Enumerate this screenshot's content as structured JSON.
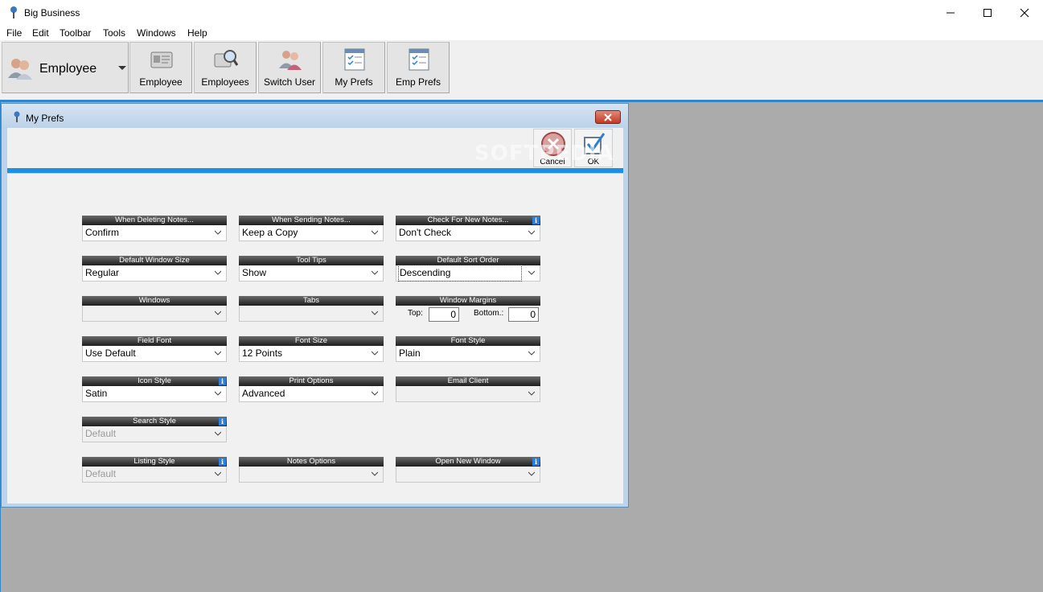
{
  "window": {
    "title": "Big Business"
  },
  "menu": [
    "File",
    "Edit",
    "Toolbar",
    "Tools",
    "Windows",
    "Help"
  ],
  "toolbar": {
    "selector": {
      "label": "Employee",
      "icon": "users-icon"
    },
    "buttons": [
      {
        "label": "Employee",
        "icon": "employee-card-icon"
      },
      {
        "label": "Employees",
        "icon": "employees-search-icon"
      },
      {
        "label": "Switch User",
        "icon": "switch-user-icon"
      },
      {
        "label": "My Prefs",
        "icon": "checklist-icon"
      },
      {
        "label": "Emp Prefs",
        "icon": "checklist-icon"
      }
    ]
  },
  "dialog": {
    "title": "My Prefs",
    "cancel_label": "Cancel",
    "ok_label": "OK",
    "watermark": "SOFTPEDIA"
  },
  "prefs": {
    "deleting": {
      "label": "When Deleting Notes...",
      "value": "Confirm"
    },
    "sending": {
      "label": "When Sending Notes...",
      "value": "Keep a Copy"
    },
    "check": {
      "label": "Check For New Notes...",
      "value": "Don't Check"
    },
    "window_size": {
      "label": "Default Window Size",
      "value": "Regular"
    },
    "tooltips": {
      "label": "Tool Tips",
      "value": "Show"
    },
    "sort_order": {
      "label": "Default Sort Order",
      "value": "Descending"
    },
    "windows": {
      "label": "Windows",
      "value": ""
    },
    "tabs": {
      "label": "Tabs",
      "value": ""
    },
    "margins": {
      "label": "Window Margins",
      "top_label": "Top:",
      "top_value": "0",
      "bottom_label": "Bottom.:",
      "bottom_value": "0"
    },
    "field_font": {
      "label": "Field Font",
      "value": "Use Default"
    },
    "font_size": {
      "label": "Font Size",
      "value": "12 Points"
    },
    "font_style": {
      "label": "Font Style",
      "value": "Plain"
    },
    "icon_style": {
      "label": "Icon Style",
      "value": "Satin"
    },
    "print_options": {
      "label": "Print Options",
      "value": "Advanced"
    },
    "email_client": {
      "label": "Email Client",
      "value": ""
    },
    "search_style": {
      "label": "Search Style",
      "value": "Default"
    },
    "listing_style": {
      "label": "Listing Style",
      "value": "Default"
    },
    "notes_options": {
      "label": "Notes Options",
      "value": ""
    },
    "open_new_window": {
      "label": "Open New Window",
      "value": ""
    }
  },
  "colors": {
    "accent_blue": "#1f8fe0",
    "workspace_gray": "#ababab",
    "header_dark": "#1e1e1e"
  }
}
